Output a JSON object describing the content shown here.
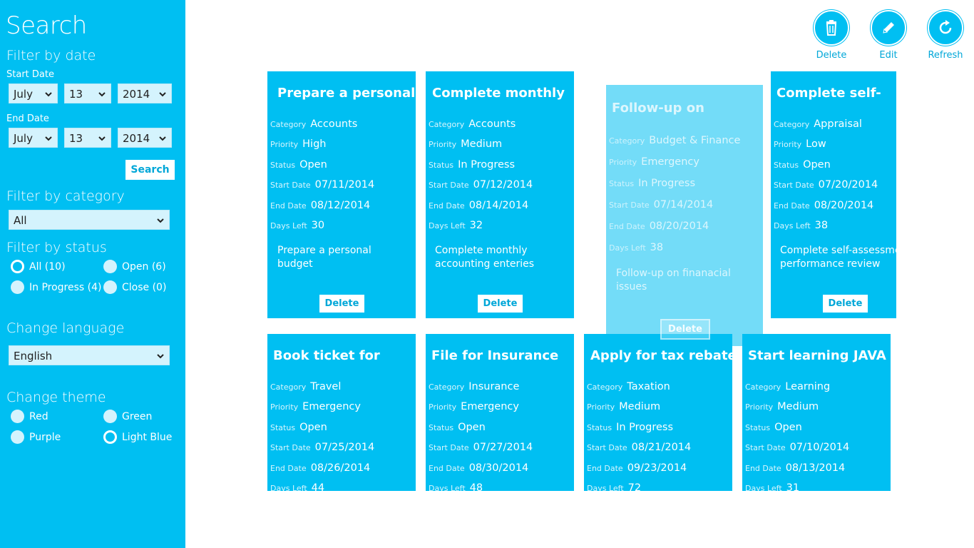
{
  "sidebar": {
    "title": "Search",
    "filter_date": {
      "heading": "Filter by date",
      "start_label": "Start Date",
      "start": {
        "month": "July",
        "day": "13",
        "year": "2014"
      },
      "end_label": "End Date",
      "end": {
        "month": "July",
        "day": "13",
        "year": "2014"
      },
      "search_button": "Search"
    },
    "filter_category": {
      "heading": "Filter by category",
      "selected": "All"
    },
    "filter_status": {
      "heading": "Filter by status",
      "options": [
        {
          "label": "All (10)",
          "selected": true
        },
        {
          "label": "Open (6)",
          "selected": false
        },
        {
          "label": "In Progress (4)",
          "selected": false
        },
        {
          "label": "Close (0)",
          "selected": false
        }
      ]
    },
    "language": {
      "heading": "Change language",
      "selected": "English"
    },
    "theme": {
      "heading": "Change theme",
      "options": [
        {
          "label": "Red",
          "selected": false
        },
        {
          "label": "Green",
          "selected": false
        },
        {
          "label": "Purple",
          "selected": false
        },
        {
          "label": "Light Blue",
          "selected": true
        }
      ]
    }
  },
  "appbar": {
    "delete": "Delete",
    "edit": "Edit",
    "refresh": "Refresh"
  },
  "field_labels": {
    "category": "Category",
    "priority": "Priority",
    "status": "Status",
    "start": "Start Date",
    "end": "End Date",
    "days": "Days Left"
  },
  "card_delete_label": "Delete",
  "cards": [
    {
      "title": "Prepare a personal",
      "category": "Accounts",
      "priority": "High",
      "status": "Open",
      "start": "07/11/2014",
      "end": "08/12/2014",
      "days": "30",
      "desc": "Prepare a personal budget"
    },
    {
      "title": "Complete monthly",
      "category": "Accounts",
      "priority": "Medium",
      "status": "In Progress",
      "start": "07/12/2014",
      "end": "08/14/2014",
      "days": "32",
      "desc": "Complete monthly accounting enteries"
    },
    {
      "title": "Follow-up on",
      "category": "Budget & Finance",
      "priority": "Emergency",
      "status": "In Progress",
      "start": "07/14/2014",
      "end": "08/20/2014",
      "days": "38",
      "desc": "Follow-up on finanacial issues"
    },
    {
      "title": "Complete self-",
      "category": "Appraisal",
      "priority": "Low",
      "status": "Open",
      "start": "07/20/2014",
      "end": "08/20/2014",
      "days": "38",
      "desc": "Complete self-assessment performance review"
    },
    {
      "title": "Book ticket for",
      "category": "Travel",
      "priority": "Emergency",
      "status": "Open",
      "start": "07/25/2014",
      "end": "08/26/2014",
      "days": "44"
    },
    {
      "title": "File for Insurance",
      "category": "Insurance",
      "priority": "Emergency",
      "status": "Open",
      "start": "07/27/2014",
      "end": "08/30/2014",
      "days": "48"
    },
    {
      "title": "Apply for tax rebate",
      "category": "Taxation",
      "priority": "Medium",
      "status": "In Progress",
      "start": "08/21/2014",
      "end": "09/23/2014",
      "days": "72"
    },
    {
      "title": "Start learning JAVA",
      "category": "Learning",
      "priority": "Medium",
      "status": "Open",
      "start": "07/10/2014",
      "end": "08/13/2014",
      "days": "31"
    }
  ]
}
